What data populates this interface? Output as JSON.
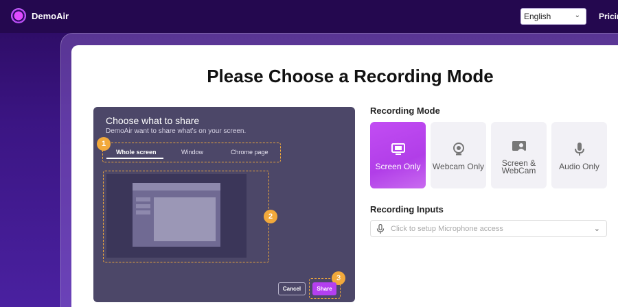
{
  "app": {
    "name": "DemoAir"
  },
  "header": {
    "language": "English",
    "pricing_label": "Pricing"
  },
  "page": {
    "title": "Please Choose a Recording Mode"
  },
  "share_dialog": {
    "title": "Choose what to share",
    "subtitle": "DemoAir want to share what's on your screen.",
    "tabs": [
      {
        "label": "Whole screen",
        "active": true
      },
      {
        "label": "Window",
        "active": false
      },
      {
        "label": "Chrome page",
        "active": false
      }
    ],
    "cancel_label": "Cancel",
    "share_label": "Share",
    "badges": [
      "1",
      "2",
      "3"
    ]
  },
  "recording_mode": {
    "label": "Recording Mode",
    "options": [
      {
        "label": "Screen Only",
        "icon": "monitor-icon",
        "selected": true
      },
      {
        "label": "Webcam Only",
        "icon": "webcam-icon",
        "selected": false
      },
      {
        "label_line1": "Screen &",
        "label_line2": "WebCam",
        "icon": "screen-webcam-icon",
        "selected": false
      },
      {
        "label": "Audio Only",
        "icon": "microphone-icon",
        "selected": false
      }
    ]
  },
  "recording_inputs": {
    "label": "Recording Inputs",
    "microphone_placeholder": "Click to setup Microphone access"
  },
  "colors": {
    "accent": "#b43ff0",
    "highlight": "#f2a93b",
    "header_bg": "#24084f"
  }
}
